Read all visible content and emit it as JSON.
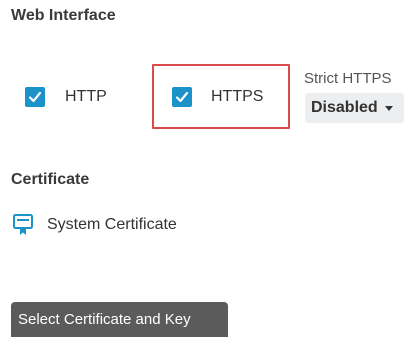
{
  "web_interface": {
    "title": "Web Interface",
    "http_label": "HTTP",
    "https_label": "HTTPS",
    "strict_https_label": "Strict HTTPS",
    "strict_https_value": "Disabled"
  },
  "certificate": {
    "title": "Certificate",
    "current": "System Certificate",
    "icon": "certificate-icon"
  },
  "tooltip": {
    "text": "Select Certificate and Key"
  },
  "colors": {
    "checkbox": "#1b93c9",
    "highlight": "#d94a4a",
    "tooltip_bg": "#5b5b5b"
  }
}
